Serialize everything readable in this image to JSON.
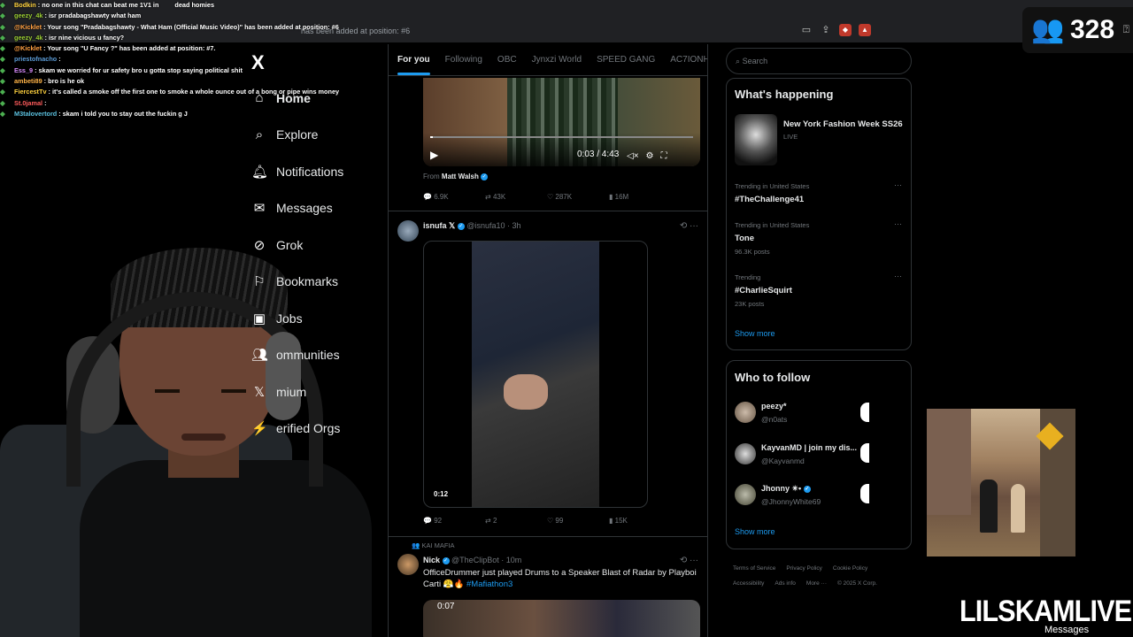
{
  "browser": {
    "url_text": "has been added at position: #6"
  },
  "chat": [
    {
      "user": "Bodkin",
      "text": "no one in this chat can beat me 1V1 in",
      "extra": "dead homies",
      "color": "#ffd23f"
    },
    {
      "user": "geezy_4k",
      "text": "isr pradabagshawty what ham",
      "color": "#9acd32"
    },
    {
      "user": "@Kicklet",
      "text": "Your song \"Pradabagshawty - What Ham (Official Music Video)\" has been added at position: #6",
      "color": "#ff9f40"
    },
    {
      "user": "geezy_4k",
      "text": "isr nine vicious u fancy?",
      "color": "#9acd32"
    },
    {
      "user": "@Kicklet",
      "text": "Your song \"U Fancy ?\" has been added at position: #7.",
      "color": "#ff9f40"
    },
    {
      "user": "priestofnacho",
      "text": "",
      "color": "#5b9bd5"
    },
    {
      "user": "Ess_9",
      "text": "skam we worried for ur safety bro u gotta stop saying political shit",
      "color": "#d98cff"
    },
    {
      "user": "ambeti89",
      "text": "bro is he ok",
      "color": "#ffb347"
    },
    {
      "user": "FiercestTv",
      "text": "it's called a smoke off the first one to smoke a whole ounce out of a bong or pipe wins money",
      "color": "#ffd23f"
    },
    {
      "user": "St.0jamal",
      "text": "",
      "color": "#ff5b5b"
    },
    {
      "user": "skam i told you to stay out the fuckin g J",
      "text": "",
      "prefix": "M3talovertord",
      "color": "#5bc0de"
    }
  ],
  "sidebar": {
    "logo": "X",
    "items": [
      {
        "label": "Home",
        "icon": "home-icon"
      },
      {
        "label": "Explore",
        "icon": "search-icon"
      },
      {
        "label": "Notifications",
        "icon": "bell-icon"
      },
      {
        "label": "Messages",
        "icon": "mail-icon"
      },
      {
        "label": "Grok",
        "icon": "grok-icon"
      },
      {
        "label": "Bookmarks",
        "icon": "bookmark-icon"
      },
      {
        "label": "Jobs",
        "icon": "jobs-icon"
      },
      {
        "label": "ommunities",
        "icon": "communities-icon"
      },
      {
        "label": "mium",
        "icon": "premium-icon"
      },
      {
        "label": "erified Orgs",
        "icon": "verified-orgs-icon"
      }
    ]
  },
  "feed": {
    "tabs": [
      "For you",
      "Following",
      "OBC",
      "Jynxzi World",
      "SPEED GANG",
      "AC7IONHOU"
    ],
    "post1": {
      "video_time": "0:03 / 4:43",
      "from_label": "From",
      "from_name": "Matt Walsh",
      "replies": "6.9K",
      "reposts": "43K",
      "likes": "287K",
      "views": "16M"
    },
    "post2": {
      "name": "isnufa",
      "handle": "@isnufa10 · 3h",
      "duration": "0:12",
      "replies": "92",
      "reposts": "2",
      "likes": "99",
      "views": "15K"
    },
    "post3": {
      "social_context": "KAI MAFIA",
      "name": "Nick",
      "handle": "@TheClipBot · 10m",
      "text": "OfficeDrummer just played Drums to a Speaker Blast of Radar by Playboi Carti 😤🔥",
      "hashtag": "#Mafiathon3",
      "video_time": "0:07"
    }
  },
  "right": {
    "search_placeholder": "Search",
    "happening_title": "What's happening",
    "event_title": "New York Fashion Week SS26",
    "event_status": "LIVE",
    "trends": [
      {
        "meta": "Trending in United States",
        "name": "#TheChallenge41",
        "posts": ""
      },
      {
        "meta": "Trending in United States",
        "name": "Tone",
        "posts": "96.3K posts"
      },
      {
        "meta": "Trending",
        "name": "#CharlieSquirt",
        "posts": "23K posts"
      }
    ],
    "show_more": "Show more",
    "follow_title": "Who to follow",
    "follow": [
      {
        "name": "peezy*",
        "handle": "@n0ats"
      },
      {
        "name": "KayvanMD | join my dis...",
        "handle": "@Kayvanmd"
      },
      {
        "name": "Jhonny ✴•",
        "handle": "@JhonnyWhite69"
      }
    ],
    "footer": [
      "Terms of Service",
      "Privacy Policy",
      "Cookie Policy",
      "Accessibility",
      "Ads info",
      "More ···",
      "© 2025 X Corp."
    ]
  },
  "overlay": {
    "viewer_count": "328",
    "brand": "LILSKAMLIVE",
    "brand_sub": "Messages"
  },
  "colors": {
    "accent": "#1d9bf0",
    "background": "#000000",
    "border": "#2f3336"
  }
}
